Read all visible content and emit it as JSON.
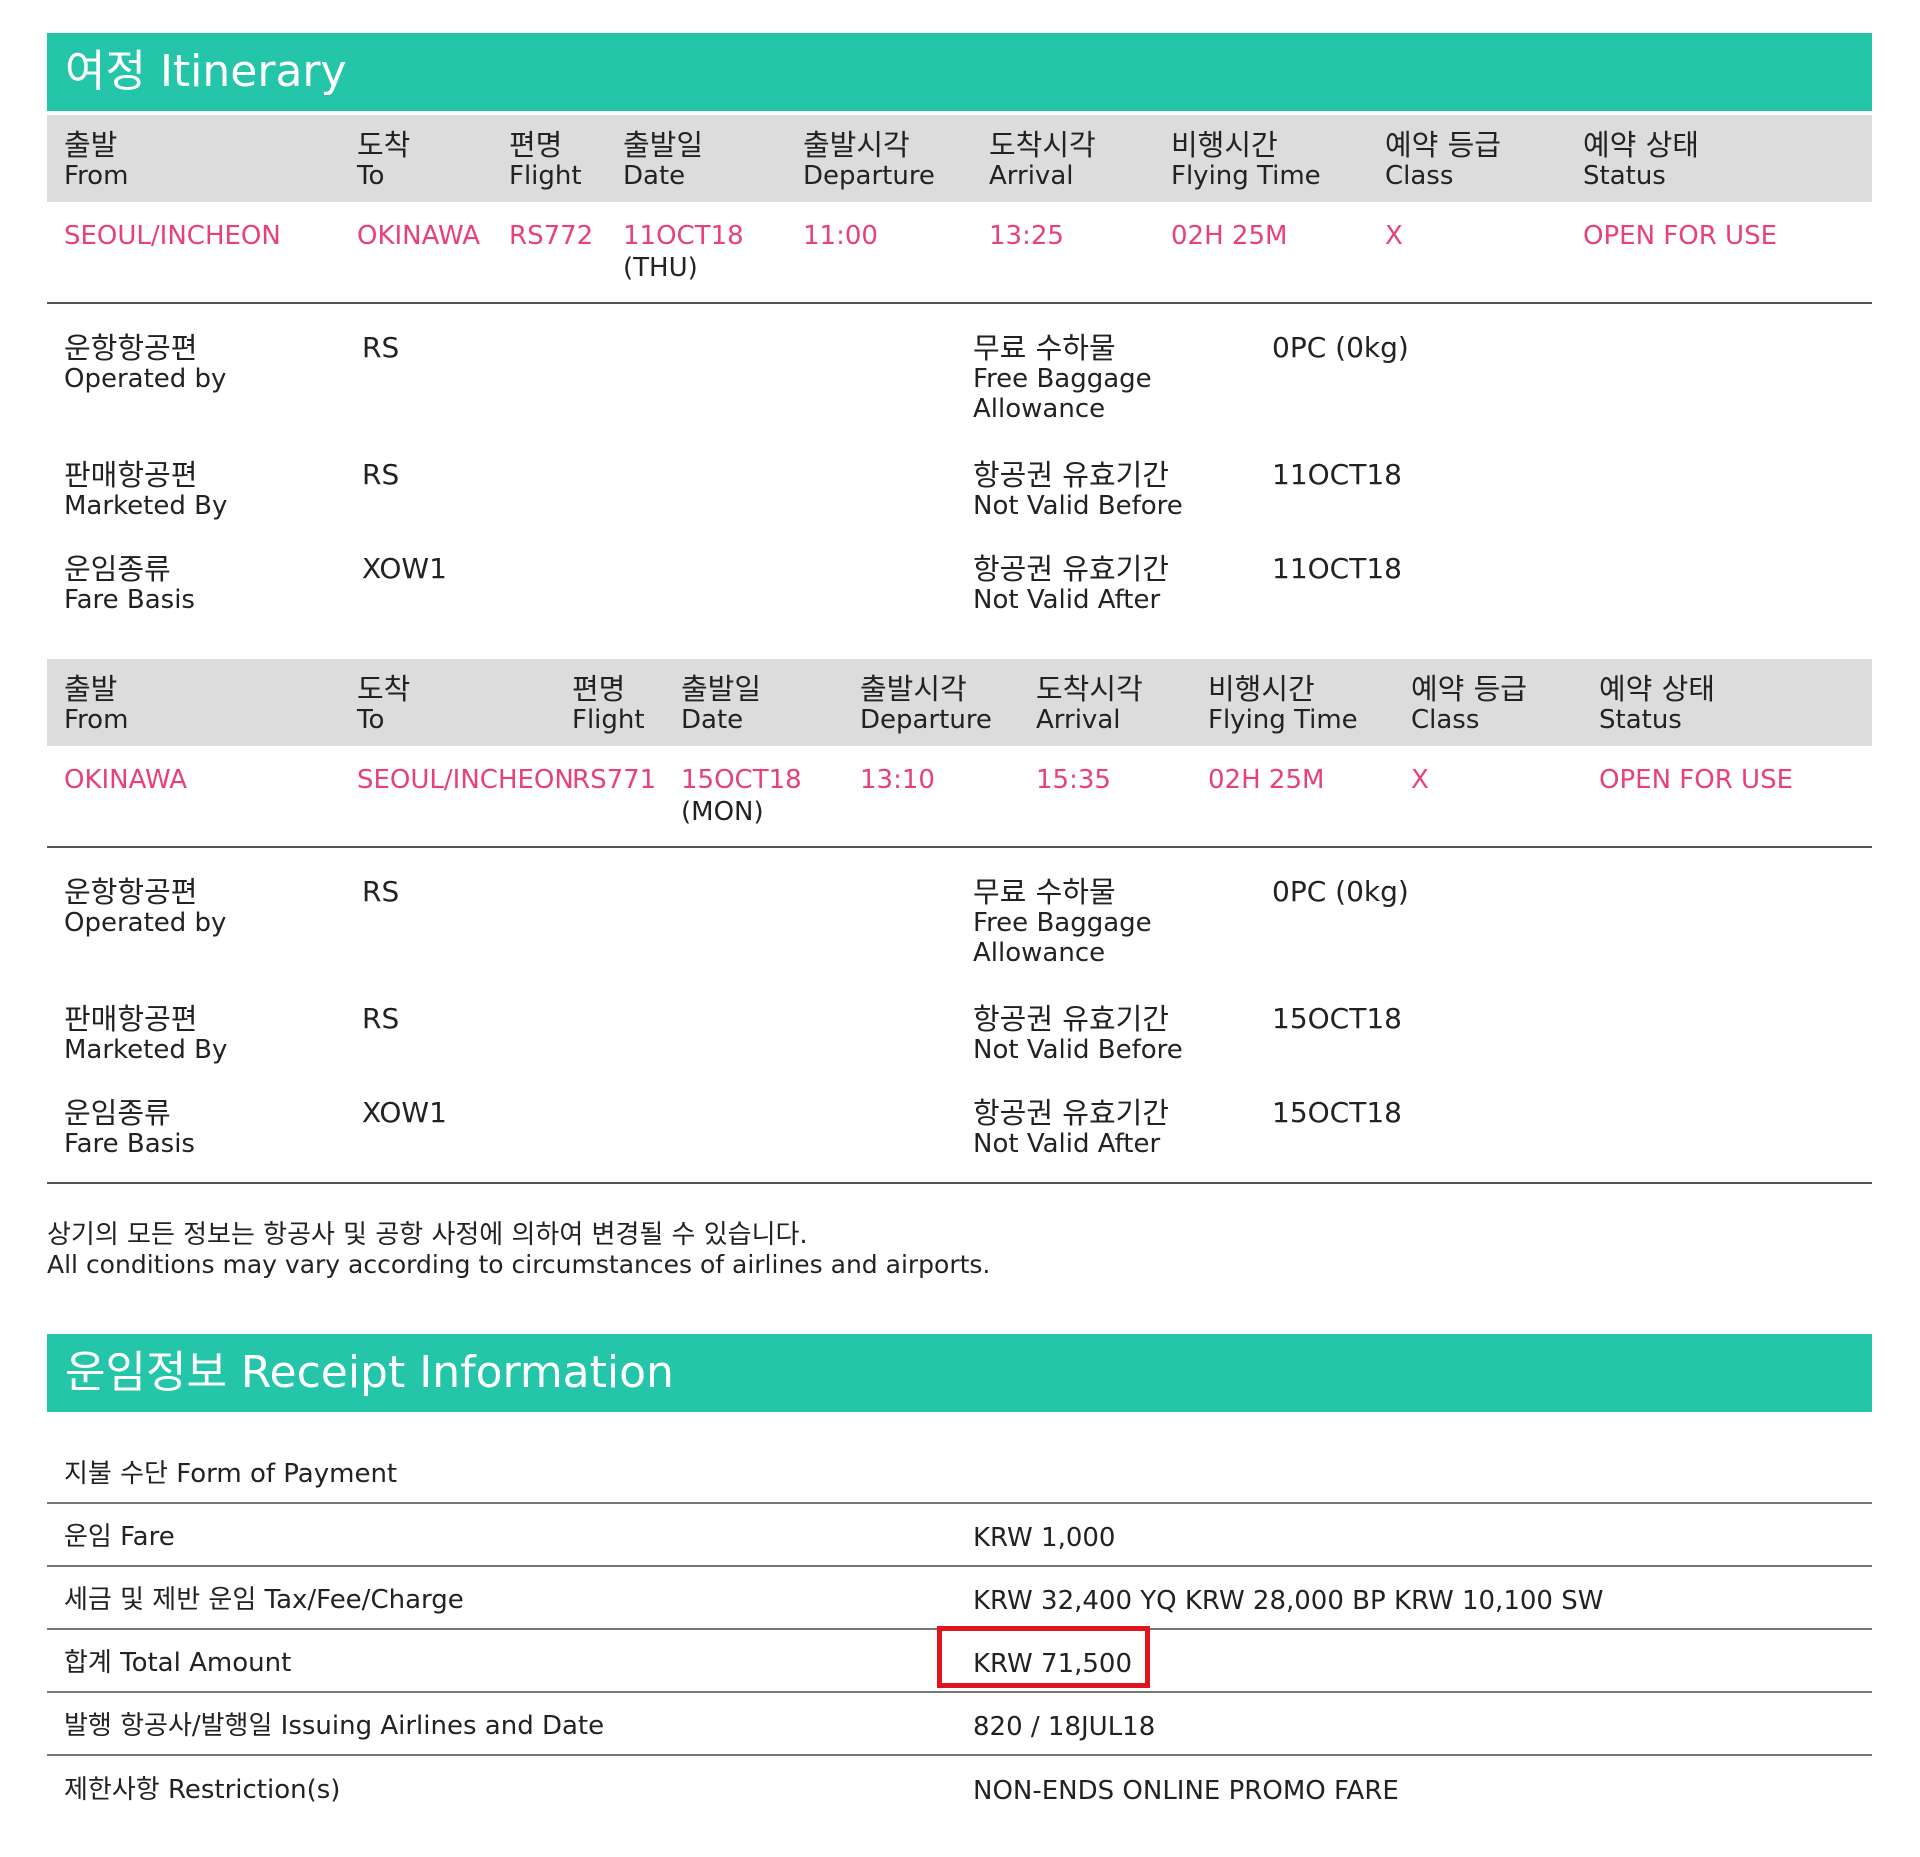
{
  "itinerary": {
    "title": "여정 Itinerary",
    "flights": [
      {
        "headers": [
          {
            "kr": "출발",
            "en": "From"
          },
          {
            "kr": "도착",
            "en": "To"
          },
          {
            "kr": "편명",
            "en": "Flight"
          },
          {
            "kr": "출발일",
            "en": "Date"
          },
          {
            "kr": "출발시각",
            "en": "Departure"
          },
          {
            "kr": "도착시각",
            "en": "Arrival"
          },
          {
            "kr": "비행시간",
            "en": "Flying Time"
          },
          {
            "kr": "예약 등급",
            "en": "Class"
          },
          {
            "kr": "예약 상태",
            "en": "Status"
          }
        ],
        "row": {
          "from": "SEOUL/INCHEON",
          "to": "OKINAWA",
          "flight": "RS772",
          "date": "11OCT18",
          "day": "(THU)",
          "departure": "11:00",
          "arrival": "13:25",
          "flying_time": "02H 25M",
          "class": "X",
          "status": "OPEN FOR USE"
        },
        "details": {
          "operated_kr": "운항항공편",
          "operated_en": "Operated by",
          "operated_val": "RS",
          "marketed_kr": "판매항공편",
          "marketed_en": "Marketed By",
          "marketed_val": "RS",
          "fare_kr": "운임종류",
          "fare_en": "Fare Basis",
          "fare_val": "XOW1",
          "baggage_kr": "무료 수하물",
          "baggage_en1": "Free Baggage",
          "baggage_en2": "Allowance",
          "baggage_val": "0PC (0kg)",
          "nvb_kr": "항공권 유효기간",
          "nvb_en": "Not Valid Before",
          "nvb_val": "11OCT18",
          "nva_kr": "항공권 유효기간",
          "nva_en": "Not Valid After",
          "nva_val": "11OCT18"
        }
      },
      {
        "headers": [
          {
            "kr": "출발",
            "en": "From"
          },
          {
            "kr": "도착",
            "en": "To"
          },
          {
            "kr": "편명",
            "en": "Flight"
          },
          {
            "kr": "출발일",
            "en": "Date"
          },
          {
            "kr": "출발시각",
            "en": "Departure"
          },
          {
            "kr": "도착시각",
            "en": "Arrival"
          },
          {
            "kr": "비행시간",
            "en": "Flying Time"
          },
          {
            "kr": "예약 등급",
            "en": "Class"
          },
          {
            "kr": "예약 상태",
            "en": "Status"
          }
        ],
        "row": {
          "from": "OKINAWA",
          "to": "SEOUL/INCHEON",
          "flight": "RS771",
          "date": "15OCT18",
          "day": "(MON)",
          "departure": "13:10",
          "arrival": "15:35",
          "flying_time": "02H 25M",
          "class": "X",
          "status": "OPEN FOR USE"
        },
        "details": {
          "operated_kr": "운항항공편",
          "operated_en": "Operated by",
          "operated_val": "RS",
          "marketed_kr": "판매항공편",
          "marketed_en": "Marketed By",
          "marketed_val": "RS",
          "fare_kr": "운임종류",
          "fare_en": "Fare Basis",
          "fare_val": "XOW1",
          "baggage_kr": "무료 수하물",
          "baggage_en1": "Free Baggage",
          "baggage_en2": "Allowance",
          "baggage_val": "0PC (0kg)",
          "nvb_kr": "항공권 유효기간",
          "nvb_en": "Not Valid Before",
          "nvb_val": "15OCT18",
          "nva_kr": "항공권 유효기간",
          "nva_en": "Not Valid After",
          "nva_val": "15OCT18"
        }
      }
    ],
    "notice_kr": "상기의 모든 정보는 항공사 및 공항 사정에 의하여 변경될 수 있습니다.",
    "notice_en": "All conditions may vary according to circumstances of airlines and airports."
  },
  "receipt": {
    "title": "운임정보 Receipt Information",
    "rows": [
      {
        "label": "지불 수단 Form of Payment",
        "value": ""
      },
      {
        "label": "운임 Fare",
        "value": "KRW 1,000"
      },
      {
        "label": "세금 및 제반 운임 Tax/Fee/Charge",
        "value": "KRW 32,400 YQ KRW 28,000 BP KRW 10,100 SW"
      },
      {
        "label": "합계 Total Amount",
        "value": "KRW 71,500"
      },
      {
        "label": "발행 항공사/발행일 Issuing Airlines and Date",
        "value": "820 / 18JUL18"
      },
      {
        "label": "제한사항 Restriction(s)",
        "value": "NON-ENDS ONLINE PROMO FARE"
      }
    ]
  },
  "colors": {
    "banner": "#25c5aa",
    "header_bg": "#dcdcdc",
    "accent_text": "#e8407a",
    "highlight_box": "#e0141e"
  }
}
